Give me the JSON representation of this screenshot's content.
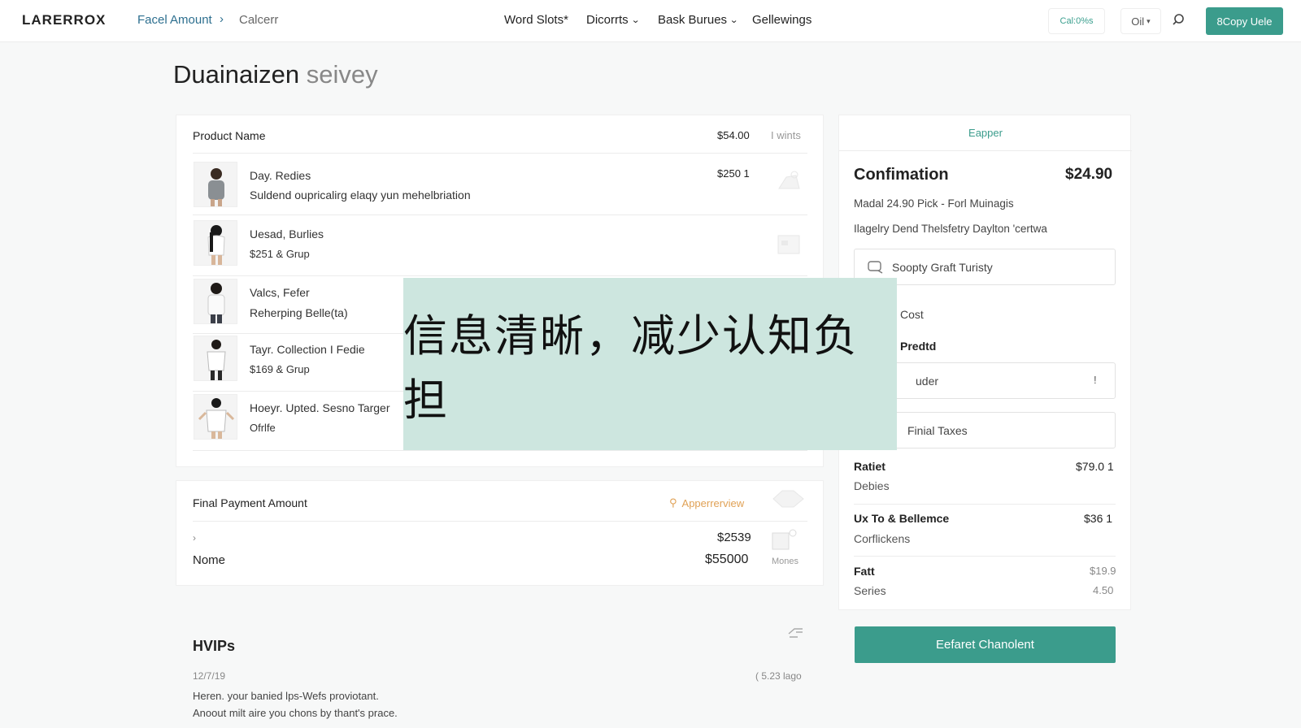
{
  "header": {
    "logo": "LARERROX",
    "breadcrumb": [
      "Facel Amount",
      "Calcerr"
    ],
    "nav": [
      {
        "label": "Word Slots*",
        "has_dropdown": false
      },
      {
        "label": "Dicorrts",
        "has_dropdown": true
      },
      {
        "label": "Bask Burues",
        "has_dropdown": true
      },
      {
        "label": "Gellewings",
        "has_dropdown": false
      }
    ],
    "btn_light": "Cal:0%s",
    "btn_select": "Oil",
    "btn_primary": "8Copy Uele"
  },
  "page": {
    "title_main": "Duainaizen",
    "title_light": "seivey"
  },
  "products": {
    "header": {
      "name": "Product Name",
      "price": "$54.00",
      "units": "I wints"
    },
    "items": [
      {
        "title": "Day. Redies",
        "subtitle": "Suldend oupricalirg elaqy yun mehelbriation",
        "price": "$250 1"
      },
      {
        "title": "Uesad, Burlies",
        "subtitle": "$251 & Grup",
        "price": ""
      },
      {
        "title": "Valcs, Fefer",
        "subtitle": "Reherping Belle(ta)",
        "price": ""
      },
      {
        "title": "Tayr. Collection I Fedie",
        "subtitle": "$169 & Grup",
        "price": ""
      },
      {
        "title": "Hoeyr. Upted. Sesno Targer",
        "subtitle": "Ofrlfe",
        "price": ""
      }
    ]
  },
  "payment": {
    "label": "Final Payment Amount",
    "link": "Apperrerview",
    "caret": "›",
    "value1": "$2539",
    "row2_label": "Nome",
    "row2_value": "$55000",
    "icon_caption": "Mones"
  },
  "hvips": {
    "title": "HVIPs",
    "date": "12/7/19",
    "meta": "( 5.23 lago",
    "line1": "Heren. your banied lps-Wefs proviotant.",
    "line2": "Anoout milt aire you chons by thant's prace."
  },
  "summary": {
    "tab": "Eapper",
    "title": "Confimation",
    "total": "$24.90",
    "line1": "Madal 24.90 Pick - Forl Muinagis",
    "line2": "Ilagelry Dend Thelsfetry Daylton 'certwa",
    "input1": "Soopty Graft Turisty",
    "cost_label": "Cost",
    "section_label": "Predtd",
    "input2": "uder",
    "input2_mark": "!",
    "input3": "Finial Taxes",
    "rows": [
      {
        "label": "Ratiet",
        "sub": "Debies",
        "value": "$79.0 1"
      },
      {
        "label": "Ux To & Bellemce",
        "sub": "Corflickens",
        "value": "$36 1"
      },
      {
        "label": "Fatt",
        "sub": "Series",
        "value": "$19.9",
        "value2": "4.50"
      }
    ],
    "cta": "Eefaret Chanolent"
  },
  "overlay": {
    "text": "信息清晰，减少认知负担"
  },
  "colors": {
    "accent": "#3b9c8c",
    "link": "#2d6f8f",
    "overlay": "#cde6df",
    "orange_link": "#e0a155"
  }
}
